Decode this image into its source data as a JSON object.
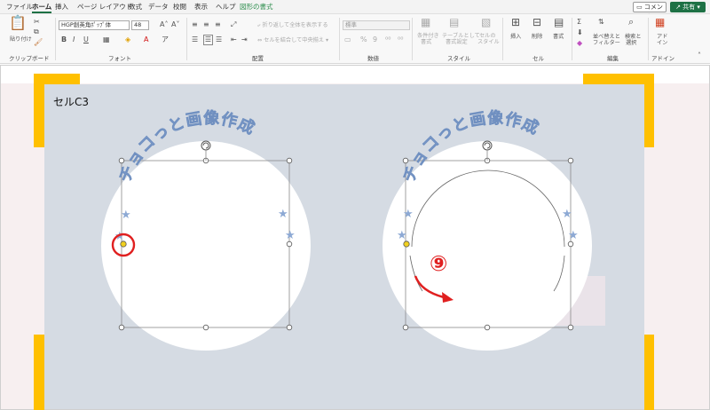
{
  "menu": {
    "tabs": [
      "ファイル",
      "ホーム",
      "挿入",
      "ページ レイアウト",
      "数式",
      "データ",
      "校閲",
      "表示",
      "ヘルプ",
      "図形の書式"
    ],
    "active_tab": "ホーム",
    "comment_label": "コメント",
    "share_label": "共有"
  },
  "ribbon": {
    "clipboard": {
      "paste": "貼り付け",
      "group": "クリップボード"
    },
    "font": {
      "name": "HGP創英角ﾎﾟｯﾌﾟ体",
      "size": "48",
      "group": "フォント"
    },
    "alignment": {
      "wrap": "折り返して全体を表示する",
      "merge": "セルを結合して中央揃え",
      "group": "配置"
    },
    "number": {
      "format": "標準",
      "group": "数値"
    },
    "styles": {
      "cond1": "条件付き",
      "cond2": "書式",
      "table1": "テーブルとして",
      "table2": "書式設定",
      "cell1": "セルの",
      "cell2": "スタイル",
      "group": "スタイル"
    },
    "cells": {
      "insert": "挿入",
      "delete": "削除",
      "format": "書式",
      "group": "セル"
    },
    "editing": {
      "sort1": "並べ替えと",
      "sort2": "フィルター",
      "find1": "検索と",
      "find2": "選択",
      "group": "編集"
    },
    "addins": {
      "label1": "アド",
      "label2": "イン",
      "group": "アドイン"
    }
  },
  "sheet": {
    "cell_label": "セルC3",
    "arc_text": "チョコっと画像作成",
    "step_number": "⑨",
    "colors": {
      "accent_yellow": "#ffc000",
      "text_blue": "#8da9d4",
      "annotation_red": "#e02020"
    }
  }
}
